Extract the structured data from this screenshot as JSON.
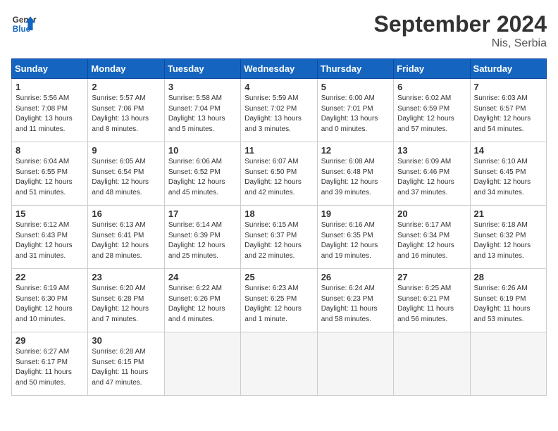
{
  "header": {
    "logo_general": "General",
    "logo_blue": "Blue",
    "month_title": "September 2024",
    "location": "Nis, Serbia"
  },
  "days_of_week": [
    "Sunday",
    "Monday",
    "Tuesday",
    "Wednesday",
    "Thursday",
    "Friday",
    "Saturday"
  ],
  "weeks": [
    [
      {
        "num": "1",
        "sunrise": "5:56 AM",
        "sunset": "7:08 PM",
        "daylight": "13 hours and 11 minutes."
      },
      {
        "num": "2",
        "sunrise": "5:57 AM",
        "sunset": "7:06 PM",
        "daylight": "13 hours and 8 minutes."
      },
      {
        "num": "3",
        "sunrise": "5:58 AM",
        "sunset": "7:04 PM",
        "daylight": "13 hours and 5 minutes."
      },
      {
        "num": "4",
        "sunrise": "5:59 AM",
        "sunset": "7:02 PM",
        "daylight": "13 hours and 3 minutes."
      },
      {
        "num": "5",
        "sunrise": "6:00 AM",
        "sunset": "7:01 PM",
        "daylight": "13 hours and 0 minutes."
      },
      {
        "num": "6",
        "sunrise": "6:02 AM",
        "sunset": "6:59 PM",
        "daylight": "12 hours and 57 minutes."
      },
      {
        "num": "7",
        "sunrise": "6:03 AM",
        "sunset": "6:57 PM",
        "daylight": "12 hours and 54 minutes."
      }
    ],
    [
      {
        "num": "8",
        "sunrise": "6:04 AM",
        "sunset": "6:55 PM",
        "daylight": "12 hours and 51 minutes."
      },
      {
        "num": "9",
        "sunrise": "6:05 AM",
        "sunset": "6:54 PM",
        "daylight": "12 hours and 48 minutes."
      },
      {
        "num": "10",
        "sunrise": "6:06 AM",
        "sunset": "6:52 PM",
        "daylight": "12 hours and 45 minutes."
      },
      {
        "num": "11",
        "sunrise": "6:07 AM",
        "sunset": "6:50 PM",
        "daylight": "12 hours and 42 minutes."
      },
      {
        "num": "12",
        "sunrise": "6:08 AM",
        "sunset": "6:48 PM",
        "daylight": "12 hours and 39 minutes."
      },
      {
        "num": "13",
        "sunrise": "6:09 AM",
        "sunset": "6:46 PM",
        "daylight": "12 hours and 37 minutes."
      },
      {
        "num": "14",
        "sunrise": "6:10 AM",
        "sunset": "6:45 PM",
        "daylight": "12 hours and 34 minutes."
      }
    ],
    [
      {
        "num": "15",
        "sunrise": "6:12 AM",
        "sunset": "6:43 PM",
        "daylight": "12 hours and 31 minutes."
      },
      {
        "num": "16",
        "sunrise": "6:13 AM",
        "sunset": "6:41 PM",
        "daylight": "12 hours and 28 minutes."
      },
      {
        "num": "17",
        "sunrise": "6:14 AM",
        "sunset": "6:39 PM",
        "daylight": "12 hours and 25 minutes."
      },
      {
        "num": "18",
        "sunrise": "6:15 AM",
        "sunset": "6:37 PM",
        "daylight": "12 hours and 22 minutes."
      },
      {
        "num": "19",
        "sunrise": "6:16 AM",
        "sunset": "6:35 PM",
        "daylight": "12 hours and 19 minutes."
      },
      {
        "num": "20",
        "sunrise": "6:17 AM",
        "sunset": "6:34 PM",
        "daylight": "12 hours and 16 minutes."
      },
      {
        "num": "21",
        "sunrise": "6:18 AM",
        "sunset": "6:32 PM",
        "daylight": "12 hours and 13 minutes."
      }
    ],
    [
      {
        "num": "22",
        "sunrise": "6:19 AM",
        "sunset": "6:30 PM",
        "daylight": "12 hours and 10 minutes."
      },
      {
        "num": "23",
        "sunrise": "6:20 AM",
        "sunset": "6:28 PM",
        "daylight": "12 hours and 7 minutes."
      },
      {
        "num": "24",
        "sunrise": "6:22 AM",
        "sunset": "6:26 PM",
        "daylight": "12 hours and 4 minutes."
      },
      {
        "num": "25",
        "sunrise": "6:23 AM",
        "sunset": "6:25 PM",
        "daylight": "12 hours and 1 minute."
      },
      {
        "num": "26",
        "sunrise": "6:24 AM",
        "sunset": "6:23 PM",
        "daylight": "11 hours and 58 minutes."
      },
      {
        "num": "27",
        "sunrise": "6:25 AM",
        "sunset": "6:21 PM",
        "daylight": "11 hours and 56 minutes."
      },
      {
        "num": "28",
        "sunrise": "6:26 AM",
        "sunset": "6:19 PM",
        "daylight": "11 hours and 53 minutes."
      }
    ],
    [
      {
        "num": "29",
        "sunrise": "6:27 AM",
        "sunset": "6:17 PM",
        "daylight": "11 hours and 50 minutes."
      },
      {
        "num": "30",
        "sunrise": "6:28 AM",
        "sunset": "6:15 PM",
        "daylight": "11 hours and 47 minutes."
      },
      null,
      null,
      null,
      null,
      null
    ]
  ]
}
